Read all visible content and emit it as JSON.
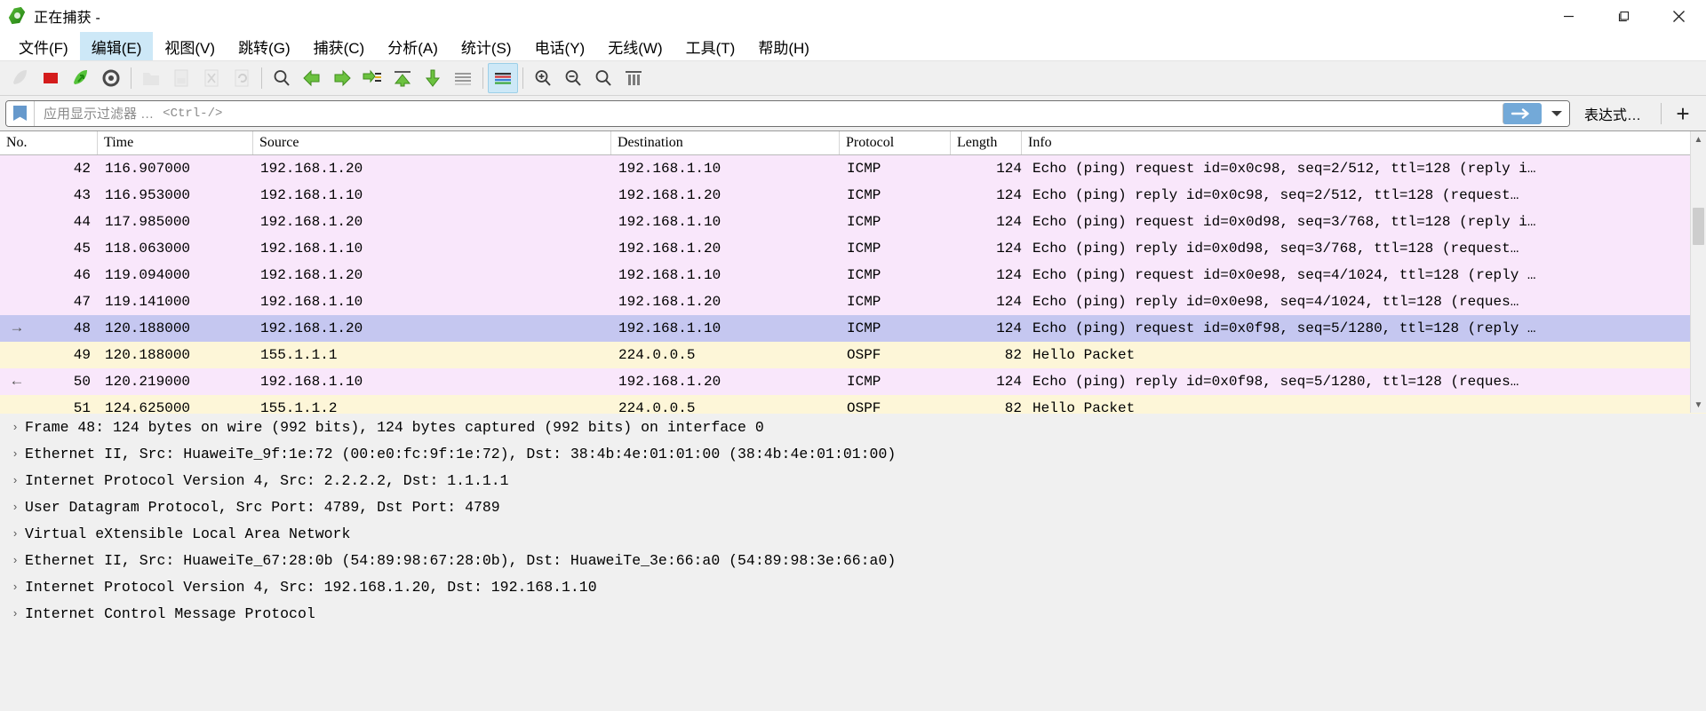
{
  "window": {
    "title": "正在捕获 -",
    "icon": "wireshark-shark-fin-icon",
    "minimize": "−",
    "maximize": "□",
    "close": "✕"
  },
  "menu": {
    "items": [
      {
        "label": "文件(F)",
        "active": false
      },
      {
        "label": "编辑(E)",
        "active": true
      },
      {
        "label": "视图(V)",
        "active": false
      },
      {
        "label": "跳转(G)",
        "active": false
      },
      {
        "label": "捕获(C)",
        "active": false
      },
      {
        "label": "分析(A)",
        "active": false
      },
      {
        "label": "统计(S)",
        "active": false
      },
      {
        "label": "电话(Y)",
        "active": false
      },
      {
        "label": "无线(W)",
        "active": false
      },
      {
        "label": "工具(T)",
        "active": false
      },
      {
        "label": "帮助(H)",
        "active": false
      }
    ]
  },
  "toolbar": {
    "buttons": [
      {
        "name": "start-capture-icon",
        "disabled": true
      },
      {
        "name": "stop-capture-icon",
        "disabled": false
      },
      {
        "name": "restart-capture-icon",
        "disabled": false
      },
      {
        "name": "capture-options-icon",
        "disabled": false
      },
      {
        "sep": true
      },
      {
        "name": "open-file-icon",
        "disabled": true
      },
      {
        "name": "save-file-icon",
        "disabled": true
      },
      {
        "name": "close-file-icon",
        "disabled": true
      },
      {
        "name": "reload-file-icon",
        "disabled": true
      },
      {
        "sep": true
      },
      {
        "name": "find-packet-icon",
        "disabled": false
      },
      {
        "name": "go-back-icon",
        "disabled": false
      },
      {
        "name": "go-forward-icon",
        "disabled": false
      },
      {
        "name": "go-to-packet-icon",
        "disabled": false
      },
      {
        "name": "go-to-first-packet-icon",
        "disabled": false
      },
      {
        "name": "go-to-last-packet-icon",
        "disabled": false
      },
      {
        "name": "auto-scroll-icon",
        "disabled": false
      },
      {
        "sep": true
      },
      {
        "name": "colorize-packets-icon",
        "selected": true
      },
      {
        "sep2": true
      },
      {
        "name": "zoom-in-icon",
        "disabled": false
      },
      {
        "name": "zoom-out-icon",
        "disabled": false
      },
      {
        "name": "zoom-reset-icon",
        "disabled": false
      },
      {
        "name": "resize-columns-icon",
        "disabled": false
      }
    ]
  },
  "filter": {
    "bookmark_icon": "bookmark-icon",
    "placeholder": "应用显示过滤器 …",
    "shortcut_hint": "<Ctrl-/>",
    "value": "",
    "apply_icon": "arrow-right-icon",
    "dropdown_icon": "chevron-down-icon",
    "expression_label": "表达式…",
    "add_label": "+"
  },
  "packet_list": {
    "columns": [
      {
        "key": "no",
        "label": "No."
      },
      {
        "key": "time",
        "label": "Time"
      },
      {
        "key": "source",
        "label": "Source"
      },
      {
        "key": "destination",
        "label": "Destination"
      },
      {
        "key": "protocol",
        "label": "Protocol"
      },
      {
        "key": "length",
        "label": "Length"
      },
      {
        "key": "info",
        "label": "Info"
      }
    ],
    "rows": [
      {
        "marker": "",
        "no": "42",
        "time": "116.907000",
        "source": "192.168.1.20",
        "destination": "192.168.1.10",
        "protocol": "ICMP",
        "length": "124",
        "info": "Echo (ping) request  id=0x0c98, seq=2/512, ttl=128 (reply i…",
        "style": "icmp"
      },
      {
        "marker": "",
        "no": "43",
        "time": "116.953000",
        "source": "192.168.1.10",
        "destination": "192.168.1.20",
        "protocol": "ICMP",
        "length": "124",
        "info": "Echo (ping) reply    id=0x0c98, seq=2/512, ttl=128 (request…",
        "style": "icmp"
      },
      {
        "marker": "",
        "no": "44",
        "time": "117.985000",
        "source": "192.168.1.20",
        "destination": "192.168.1.10",
        "protocol": "ICMP",
        "length": "124",
        "info": "Echo (ping) request  id=0x0d98, seq=3/768, ttl=128 (reply i…",
        "style": "icmp"
      },
      {
        "marker": "",
        "no": "45",
        "time": "118.063000",
        "source": "192.168.1.10",
        "destination": "192.168.1.20",
        "protocol": "ICMP",
        "length": "124",
        "info": "Echo (ping) reply    id=0x0d98, seq=3/768, ttl=128 (request…",
        "style": "icmp"
      },
      {
        "marker": "",
        "no": "46",
        "time": "119.094000",
        "source": "192.168.1.20",
        "destination": "192.168.1.10",
        "protocol": "ICMP",
        "length": "124",
        "info": "Echo (ping) request  id=0x0e98, seq=4/1024, ttl=128 (reply …",
        "style": "icmp"
      },
      {
        "marker": "",
        "no": "47",
        "time": "119.141000",
        "source": "192.168.1.10",
        "destination": "192.168.1.20",
        "protocol": "ICMP",
        "length": "124",
        "info": "Echo (ping) reply    id=0x0e98, seq=4/1024, ttl=128 (reques…",
        "style": "icmp"
      },
      {
        "marker": "→",
        "no": "48",
        "time": "120.188000",
        "source": "192.168.1.20",
        "destination": "192.168.1.10",
        "protocol": "ICMP",
        "length": "124",
        "info": "Echo (ping) request  id=0x0f98, seq=5/1280, ttl=128 (reply …",
        "style": "sel"
      },
      {
        "marker": "",
        "no": "49",
        "time": "120.188000",
        "source": "155.1.1.1",
        "destination": "224.0.0.5",
        "protocol": "OSPF",
        "length": "82",
        "info": "Hello Packet",
        "style": "ospf"
      },
      {
        "marker": "←",
        "no": "50",
        "time": "120.219000",
        "source": "192.168.1.10",
        "destination": "192.168.1.20",
        "protocol": "ICMP",
        "length": "124",
        "info": "Echo (ping) reply    id=0x0f98, seq=5/1280, ttl=128 (reques…",
        "style": "icmp"
      },
      {
        "marker": "",
        "no": "51",
        "time": "124.625000",
        "source": "155.1.1.2",
        "destination": "224.0.0.5",
        "protocol": "OSPF",
        "length": "82",
        "info": "Hello Packet",
        "style": "ospf"
      }
    ]
  },
  "packet_detail": {
    "rows": [
      {
        "twisty": "›",
        "text": "Frame 48: 124 bytes on wire (992 bits), 124 bytes captured (992 bits) on interface 0"
      },
      {
        "twisty": "›",
        "text": "Ethernet II, Src: HuaweiTe_9f:1e:72 (00:e0:fc:9f:1e:72), Dst: 38:4b:4e:01:01:00 (38:4b:4e:01:01:00)"
      },
      {
        "twisty": "›",
        "text": "Internet Protocol Version 4, Src: 2.2.2.2, Dst: 1.1.1.1"
      },
      {
        "twisty": "›",
        "text": "User Datagram Protocol, Src Port: 4789, Dst Port: 4789"
      },
      {
        "twisty": "›",
        "text": "Virtual eXtensible Local Area Network"
      },
      {
        "twisty": "›",
        "text": "Ethernet II, Src: HuaweiTe_67:28:0b (54:89:98:67:28:0b), Dst: HuaweiTe_3e:66:a0 (54:89:98:3e:66:a0)"
      },
      {
        "twisty": "›",
        "text": "Internet Protocol Version 4, Src: 192.168.1.20, Dst: 192.168.1.10"
      },
      {
        "twisty": "›",
        "text": "Internet Control Message Protocol"
      }
    ]
  },
  "colors": {
    "icmp_row": "#f9e7fb",
    "ospf_row": "#fdf6d8",
    "selected_row": "#c5c7f0",
    "menu_active": "#cde8f7",
    "filter_apply": "#73a9d8",
    "detail_bg": "#f0f0f0"
  }
}
